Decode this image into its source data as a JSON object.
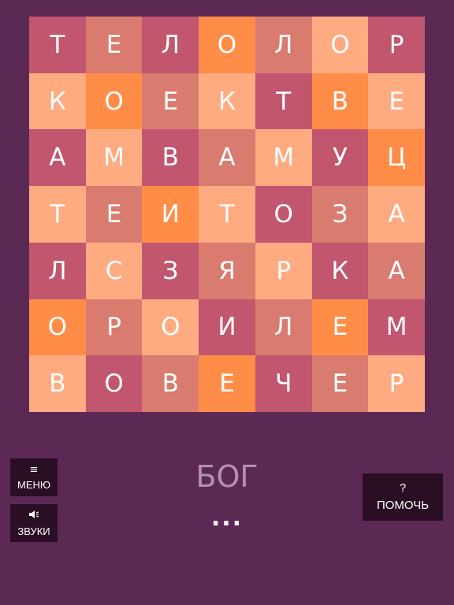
{
  "board": {
    "rows": [
      {
        "cells": [
          {
            "letter": "Т",
            "tone": "c1"
          },
          {
            "letter": "Е",
            "tone": "c2"
          },
          {
            "letter": "Л",
            "tone": "c1"
          },
          {
            "letter": "О",
            "tone": "c3"
          },
          {
            "letter": "Л",
            "tone": "c2"
          },
          {
            "letter": "О",
            "tone": "c4"
          },
          {
            "letter": "Р",
            "tone": "c1"
          }
        ]
      },
      {
        "cells": [
          {
            "letter": "К",
            "tone": "c4"
          },
          {
            "letter": "О",
            "tone": "c3"
          },
          {
            "letter": "Е",
            "tone": "c2"
          },
          {
            "letter": "К",
            "tone": "c4"
          },
          {
            "letter": "Т",
            "tone": "c1"
          },
          {
            "letter": "В",
            "tone": "c3"
          },
          {
            "letter": "Е",
            "tone": "c4"
          }
        ]
      },
      {
        "cells": [
          {
            "letter": "А",
            "tone": "c1"
          },
          {
            "letter": "М",
            "tone": "c4"
          },
          {
            "letter": "В",
            "tone": "c1"
          },
          {
            "letter": "А",
            "tone": "c2"
          },
          {
            "letter": "М",
            "tone": "c4"
          },
          {
            "letter": "У",
            "tone": "c1"
          },
          {
            "letter": "Ц",
            "tone": "c3"
          }
        ]
      },
      {
        "cells": [
          {
            "letter": "Т",
            "tone": "c4"
          },
          {
            "letter": "Е",
            "tone": "c2"
          },
          {
            "letter": "И",
            "tone": "c3"
          },
          {
            "letter": "Т",
            "tone": "c4"
          },
          {
            "letter": "О",
            "tone": "c1"
          },
          {
            "letter": "З",
            "tone": "c2"
          },
          {
            "letter": "А",
            "tone": "c4"
          }
        ]
      },
      {
        "cells": [
          {
            "letter": "Л",
            "tone": "c1"
          },
          {
            "letter": "С",
            "tone": "c4"
          },
          {
            "letter": "З",
            "tone": "c1"
          },
          {
            "letter": "Я",
            "tone": "c2"
          },
          {
            "letter": "Р",
            "tone": "c4"
          },
          {
            "letter": "К",
            "tone": "c1"
          },
          {
            "letter": "А",
            "tone": "c2"
          }
        ]
      },
      {
        "cells": [
          {
            "letter": "О",
            "tone": "c3"
          },
          {
            "letter": "Р",
            "tone": "c2"
          },
          {
            "letter": "О",
            "tone": "c4"
          },
          {
            "letter": "И",
            "tone": "c1"
          },
          {
            "letter": "Л",
            "tone": "c2"
          },
          {
            "letter": "Е",
            "tone": "c3"
          },
          {
            "letter": "М",
            "tone": "c1"
          }
        ]
      },
      {
        "cells": [
          {
            "letter": "В",
            "tone": "c4"
          },
          {
            "letter": "О",
            "tone": "c1"
          },
          {
            "letter": "В",
            "tone": "c2"
          },
          {
            "letter": "Е",
            "tone": "c3"
          },
          {
            "letter": "Ч",
            "tone": "c1"
          },
          {
            "letter": "Е",
            "tone": "c2"
          },
          {
            "letter": "Р",
            "tone": "c4"
          }
        ]
      }
    ]
  },
  "colors": {
    "background": "#5c2955",
    "tile_dark_rose": "#c1566e",
    "tile_salmon": "#d97b6f",
    "tile_orange": "#ff8c47",
    "tile_peach": "#ffab82",
    "button_bg": "#2a0e24",
    "word_color": "#b58fb0"
  },
  "menu_button": {
    "icon": "hamburger-icon",
    "icon_glyph": "≡",
    "label": "МЕНЮ"
  },
  "sound_button": {
    "icon": "speaker-icon",
    "icon_glyph": "🔈",
    "label": "ЗВУКИ"
  },
  "help_button": {
    "icon": "question-icon",
    "icon_glyph": "?",
    "label": "ПОМОЧЬ"
  },
  "current_word": "БОГ",
  "progress_dots": "..."
}
